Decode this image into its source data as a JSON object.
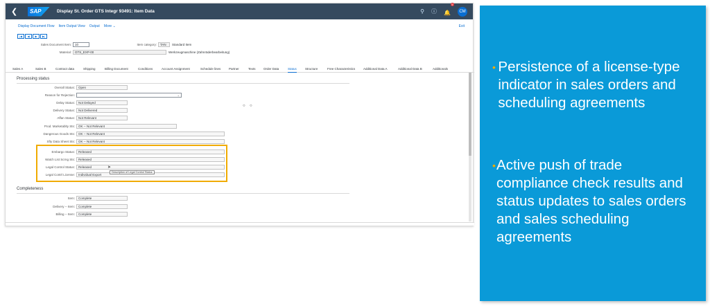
{
  "shell": {
    "logo": "SAP",
    "title": "Display St. Order GTS Integr 93491: Item Data",
    "notification_count": "5",
    "avatar": "CM"
  },
  "toolbar": {
    "items": [
      "Display Document Flow",
      "Item Output View",
      "Output",
      "More ⌄"
    ],
    "exit": "Exit"
  },
  "nav_buttons": [
    "|◀",
    "◀",
    "▶",
    "▶|"
  ],
  "header": {
    "sales_doc_item_label": "Sales Document Item:",
    "sales_doc_item_value": "10",
    "item_category_label": "Item category:",
    "item_category_value": "TAN",
    "item_category_text": "Standard Item",
    "material_label": "Material:",
    "material_value": "GTS_EXP-00",
    "material_text": "Werkzeugmaschine (Zahnräderbearbeitung)"
  },
  "tabs": [
    "Sales A",
    "Sales B",
    "Contract data",
    "Shipping",
    "Billing Document",
    "Conditions",
    "Account Assignment",
    "Schedule lines",
    "Partner",
    "Texts",
    "Order Data",
    "Status",
    "Structure",
    "Free Characteristics",
    "Additional Data A",
    "Additional Data B",
    "Additionals"
  ],
  "active_tab": "Status",
  "processing": {
    "title": "Processing status",
    "fields": [
      {
        "label": "Overall Status:",
        "value": "Open"
      },
      {
        "label": "Reason for Rejection:",
        "value": ""
      },
      {
        "label": "Delay Status:",
        "value": "Not Delayed"
      },
      {
        "label": "Delivery Status:",
        "value": "Not Delivered"
      },
      {
        "label": "Affan Status:",
        "value": "Not Relevant"
      },
      {
        "label": "Prod. Marketablty Sts:",
        "value": "OK -- Not Relevant"
      },
      {
        "label": "Dangerous Goods Sts:",
        "value": "OK -- Not Relevant"
      },
      {
        "label": "Sfty Data Sheet Sts:",
        "value": "OK -- Not Relevant"
      },
      {
        "label": "Embargo Status:",
        "value": "Released"
      },
      {
        "label": "Watch List Scrng Sts:",
        "value": "Released"
      },
      {
        "label": "Legal Control Status:",
        "value": "Released"
      },
      {
        "label": "Legal Contrl License:",
        "value": "Individual Export"
      }
    ],
    "tooltip": "Description of Legal Control Status"
  },
  "completeness": {
    "title": "Completeness",
    "fields": [
      {
        "label": "Item:",
        "value": "Complete"
      },
      {
        "label": "Delivery -- Item:",
        "value": "Complete"
      },
      {
        "label": "Billing -- Item:",
        "value": "Complete"
      }
    ]
  },
  "panel": {
    "bullets": [
      "Persistence of a license-type indicator in sales orders and scheduling agreements",
      "Active push of trade compliance check results and status updates to sales orders and sales scheduling agreements"
    ]
  },
  "colors": {
    "shell": "#354a5f",
    "panel": "#0a9ad8",
    "highlight": "#f0ab00",
    "link": "#0a6ed1"
  }
}
